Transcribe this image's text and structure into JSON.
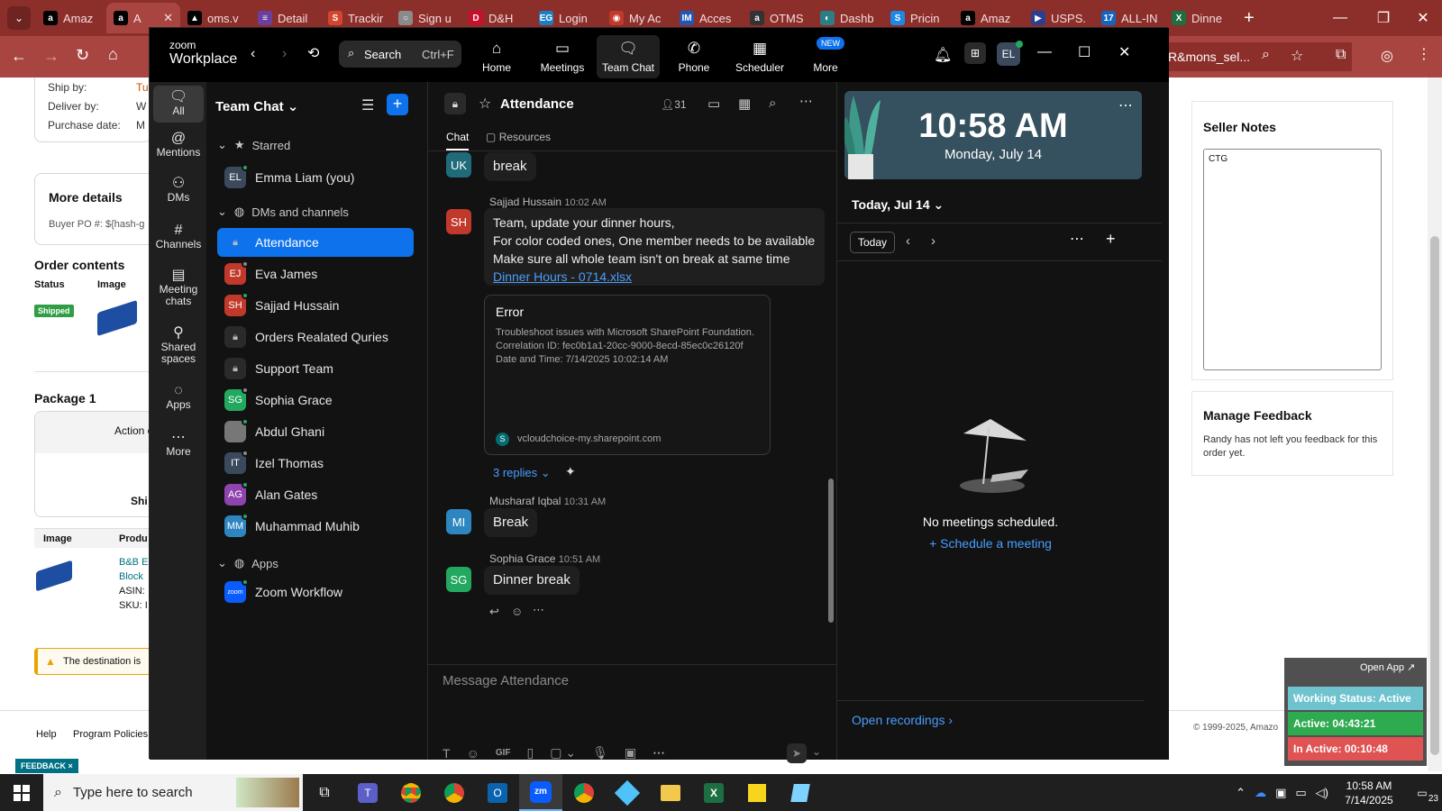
{
  "browser": {
    "tabs": [
      {
        "label": "Amaz",
        "color": "#000000",
        "glyph": "a"
      },
      {
        "label": "A",
        "color": "#000000",
        "glyph": "a"
      },
      {
        "label": "oms.v",
        "color": "#000000",
        "glyph": "▲"
      },
      {
        "label": "Detail",
        "color": "#6b3fa0",
        "glyph": "≡"
      },
      {
        "label": "Trackir",
        "color": "#d1462f",
        "glyph": "S"
      },
      {
        "label": "Sign u",
        "color": "#8a8a8a",
        "glyph": "○"
      },
      {
        "label": "D&H",
        "color": "#c8102e",
        "glyph": "D"
      },
      {
        "label": "Login",
        "color": "#1a7fc1",
        "glyph": "EG"
      },
      {
        "label": "My Ac",
        "color": "#c0392b",
        "glyph": "◉"
      },
      {
        "label": "Acces",
        "color": "#2257b4",
        "glyph": "IM"
      },
      {
        "label": "OTMS",
        "color": "#333333",
        "glyph": "a"
      },
      {
        "label": "Dashb",
        "color": "#2a7f86",
        "glyph": "◐"
      },
      {
        "label": "Pricin",
        "color": "#1e88e5",
        "glyph": "S"
      },
      {
        "label": "Amaz",
        "color": "#000000",
        "glyph": "a"
      },
      {
        "label": "USPS.",
        "color": "#2c3e8f",
        "glyph": "▶"
      },
      {
        "label": "ALL-IN",
        "color": "#1565c0",
        "glyph": "17"
      },
      {
        "label": "Dinne",
        "color": "#1d6f42",
        "glyph": "X"
      }
    ],
    "url_fragment": "R&mons_sel..."
  },
  "amazon": {
    "ship_by_label": "Ship by:",
    "ship_by_value": "Tu",
    "deliver_by_label": "Deliver by:",
    "deliver_by_value": "W",
    "purchase_date_label": "Purchase date:",
    "purchase_date_value": "M",
    "more_details_title": "More details",
    "buyer_po": "Buyer PO #: ${hash-g",
    "order_contents_title": "Order contents",
    "col_status": "Status",
    "col_image": "Image",
    "shipped_badge": "Shipped",
    "package_title": "Package 1",
    "action_text": "Action c",
    "ship_text": "Shi",
    "col_image2": "Image",
    "col_product": "Produ",
    "product_line1": "B&B E",
    "product_line2": "Block",
    "asin": "ASIN: ",
    "sku": "SKU: I",
    "warning": "The destination is",
    "help": "Help",
    "program_policies": "Program Policies",
    "copyright": "© 1999-2025, Amazo",
    "feedback_btn": "FEEDBACK ×",
    "seller_notes_title": "Seller Notes",
    "seller_notes_value": "CTG",
    "manage_feedback_title": "Manage Feedback",
    "manage_feedback_text": "Randy has not left you feedback for this order yet."
  },
  "zoom": {
    "brand_top": "zoom",
    "brand_bottom": "Workplace",
    "search_label": "Search",
    "search_shortcut": "Ctrl+F",
    "nav": [
      {
        "label": "Home"
      },
      {
        "label": "Meetings"
      },
      {
        "label": "Team Chat"
      },
      {
        "label": "Phone"
      },
      {
        "label": "Scheduler"
      },
      {
        "label": "More"
      }
    ],
    "new_badge": "NEW",
    "user_initials": "EL",
    "rail": [
      {
        "label": "All"
      },
      {
        "label": "Mentions"
      },
      {
        "label": "DMs"
      },
      {
        "label": "Channels"
      },
      {
        "label": "Meeting chats"
      },
      {
        "label": "Shared spaces"
      },
      {
        "label": "Apps"
      },
      {
        "label": "More"
      }
    ],
    "sidebar": {
      "title": "Team Chat",
      "starred": "Starred",
      "dms": "DMs and channels",
      "apps": "Apps",
      "items": [
        {
          "name": "Emma Liam (you)",
          "initials": "EL",
          "color": "#3a4a5c"
        },
        {
          "name": "Attendance",
          "initials": "",
          "color": ""
        },
        {
          "name": "Eva James",
          "initials": "EJ",
          "color": "#c0392b"
        },
        {
          "name": "Sajjad Hussain",
          "initials": "SH",
          "color": "#c0392b"
        },
        {
          "name": "Orders Realated Quries",
          "initials": "",
          "color": ""
        },
        {
          "name": "Support Team",
          "initials": "",
          "color": ""
        },
        {
          "name": "Sophia Grace",
          "initials": "SG",
          "color": "#23a860"
        },
        {
          "name": "Abdul Ghani",
          "initials": "",
          "color": "#777777"
        },
        {
          "name": "Izel Thomas",
          "initials": "IT",
          "color": "#3a4a5c"
        },
        {
          "name": "Alan Gates",
          "initials": "AG",
          "color": "#8e44ad"
        },
        {
          "name": "Muhammad Muhib",
          "initials": "MM",
          "color": "#2e86c1"
        },
        {
          "name": "Zoom Workflow",
          "initials": "zoom",
          "color": "#0b5cff"
        }
      ]
    },
    "channel": {
      "name": "Attendance",
      "member_count": "31",
      "tab_chat": "Chat",
      "tab_resources": "Resources"
    },
    "messages": {
      "m0_initials": "UK",
      "m0_text": "break",
      "m1_author": "Sajjad Hussain",
      "m1_time": "10:02 AM",
      "m1_initials": "SH",
      "m1_line1": "Team, update your dinner hours,",
      "m1_line2": "For color coded ones, One member needs to be available",
      "m1_line3": "Make sure all whole team isn't on break at same time",
      "m1_link": "Dinner Hours - 0714.xlsx",
      "err_title": "Error",
      "err_body": "Troubleshoot issues with Microsoft SharePoint Foundation. Correlation ID: fec0b1a1-20cc-9000-8ecd-85ec0c26120f Date and Time: 7/14/2025 10:02:14 AM",
      "err_domain": "vcloudchoice-my.sharepoint.com",
      "replies": "3 replies",
      "m2_author": "Musharaf Iqbal",
      "m2_time": "10:31 AM",
      "m2_initials": "MI",
      "m2_text": "Break",
      "m3_author": "Sophia Grace",
      "m3_time": "10:51 AM",
      "m3_initials": "SG",
      "m3_text": "Dinner break"
    },
    "composer_placeholder": "Message Attendance",
    "calendar": {
      "clock": "10:58 AM",
      "date": "Monday, July 14",
      "today_header": "Today, Jul 14",
      "today_btn": "Today",
      "empty": "No meetings scheduled.",
      "schedule": "Schedule a meeting",
      "recordings": "Open recordings"
    }
  },
  "widget": {
    "open_app": "Open App ↗",
    "status": "Working Status: Active",
    "active": "Active: 04:43:21",
    "inactive": "In Active: 00:10:48"
  },
  "taskbar": {
    "search_placeholder": "Type here to search",
    "time": "10:58 AM",
    "date": "7/14/2025",
    "notif_count": "23"
  }
}
